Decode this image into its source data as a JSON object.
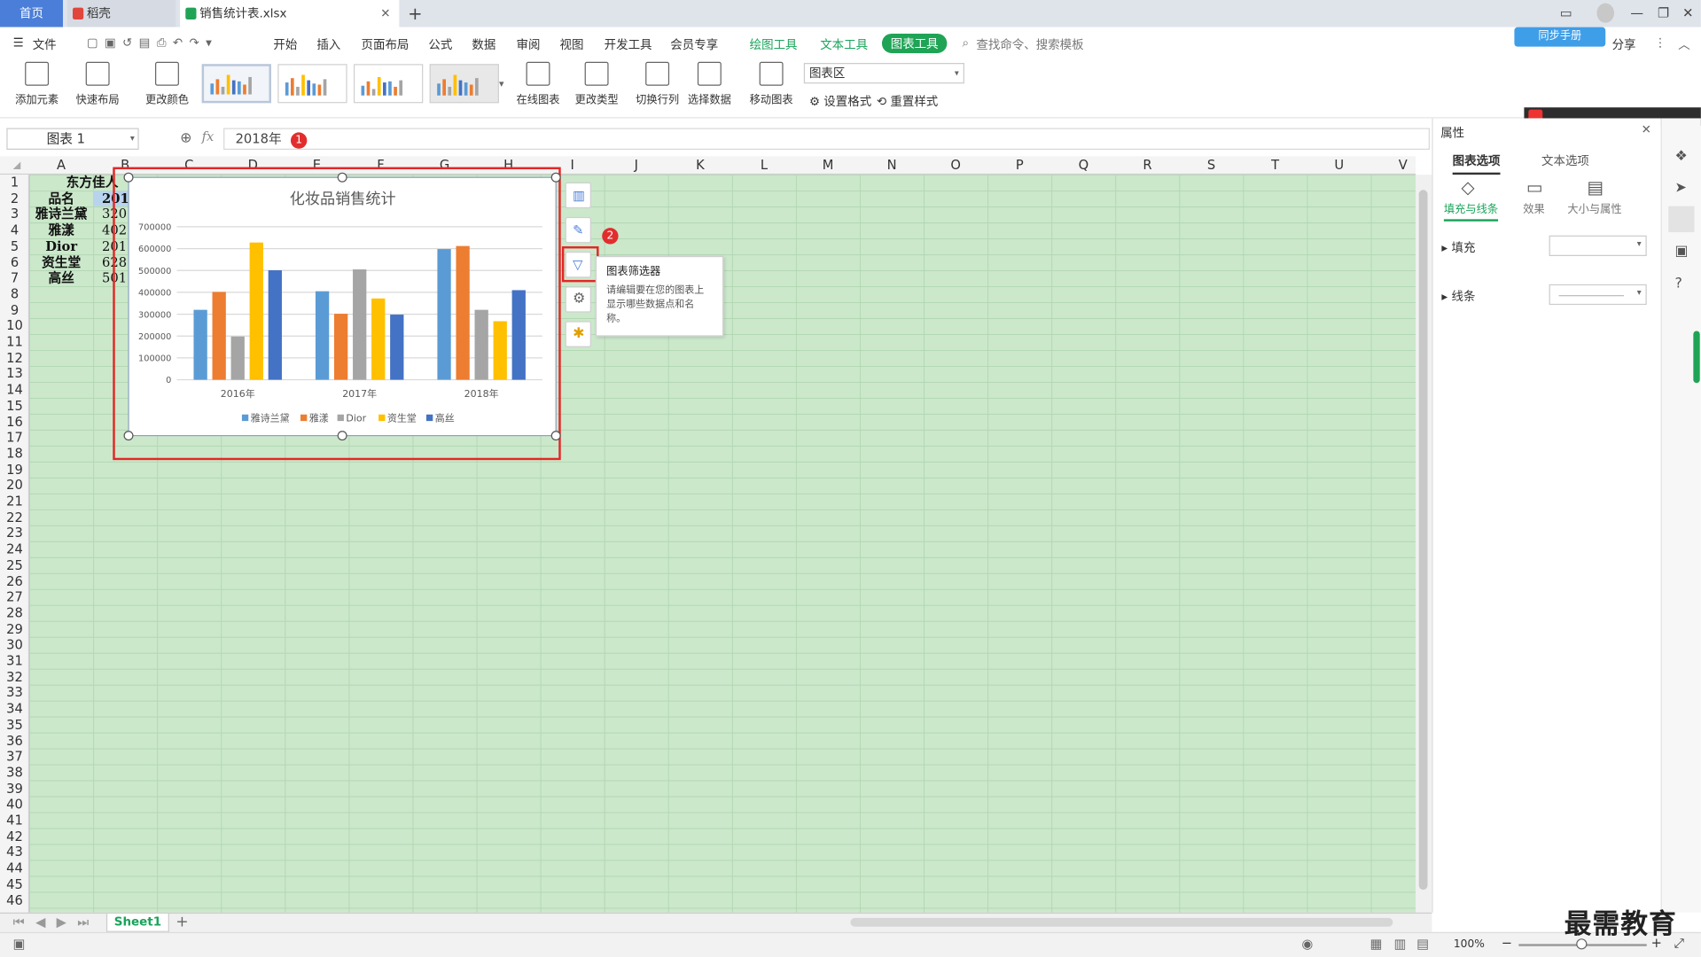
{
  "tabs": {
    "home": "首页",
    "daoke": "稻壳",
    "file": "销售统计表.xlsx",
    "add": "+"
  },
  "menu": {
    "file": "文件",
    "items": [
      "开始",
      "插入",
      "页面布局",
      "公式",
      "数据",
      "审阅",
      "视图",
      "开发工具",
      "会员专享"
    ],
    "tools": [
      "绘图工具",
      "文本工具"
    ],
    "active_tool": "图表工具",
    "search": "查找命令、搜索模板",
    "share": "分享",
    "sync_button": "同步手册"
  },
  "ribbon": {
    "add_element": "添加元素",
    "quick_layout": "快速布局",
    "change_color": "更改颜色",
    "online_chart": "在线图表",
    "change_type": "更改类型",
    "switch_rowcol": "切换行列",
    "select_data": "选择数据",
    "move_chart": "移动图表",
    "chart_area_select": "图表区",
    "set_format": "设置格式",
    "reset_style": "重置样式"
  },
  "formula": {
    "namebox": "图表 1",
    "fx": "fx",
    "value": "2018年",
    "marker1": "1"
  },
  "grid": {
    "columns": [
      "A",
      "B",
      "C",
      "D",
      "E",
      "F",
      "G",
      "H",
      "I",
      "J",
      "K",
      "L",
      "M",
      "N",
      "O",
      "P",
      "Q",
      "R",
      "S",
      "T",
      "U",
      "V"
    ],
    "rows_count": 46,
    "cells": {
      "A1": "东方佳人",
      "A2": "品名",
      "B2": "201",
      "A3": "雅诗兰黛",
      "B3": "320",
      "A4": "雅漾",
      "B4": "402",
      "A5": "Dior",
      "B5": "201",
      "A6": "资生堂",
      "B6": "628",
      "A7": "高丝",
      "B7": "501"
    }
  },
  "chart_data": {
    "type": "bar",
    "title": "化妆品销售统计",
    "categories": [
      "2016年",
      "2017年",
      "2018年"
    ],
    "ylim": [
      0,
      700000
    ],
    "yticks": [
      "0",
      "100000",
      "200000",
      "300000",
      "400000",
      "500000",
      "600000",
      "700000"
    ],
    "legend_position": "bottom",
    "series": [
      {
        "name": "雅诗兰黛",
        "color": "#5b9bd5",
        "values": [
          320000,
          405000,
          598000
        ]
      },
      {
        "name": "雅漾",
        "color": "#ed7d31",
        "values": [
          402000,
          302000,
          612000
        ]
      },
      {
        "name": "Dior",
        "color": "#a5a5a5",
        "values": [
          198000,
          505000,
          320000
        ]
      },
      {
        "name": "资生堂",
        "color": "#ffc000",
        "values": [
          628000,
          372000,
          268000
        ]
      },
      {
        "name": "高丝",
        "color": "#4472c4",
        "values": [
          501000,
          298000,
          410000
        ]
      }
    ]
  },
  "chart_tools": {
    "marker2": "2",
    "tooltip_title": "图表筛选器",
    "tooltip_body": "请编辑要在您的图表上显示哪些数据点和名称。"
  },
  "panel": {
    "title": "属性",
    "tab_chart": "图表选项",
    "tab_text": "文本选项",
    "sub_fill": "填充与线条",
    "sub_effect": "效果",
    "sub_size": "大小与属性",
    "fill": "填充",
    "line": "线条"
  },
  "sheet": {
    "name": "Sheet1"
  },
  "status": {
    "zoom": "100%"
  },
  "watermark": "最需教育"
}
